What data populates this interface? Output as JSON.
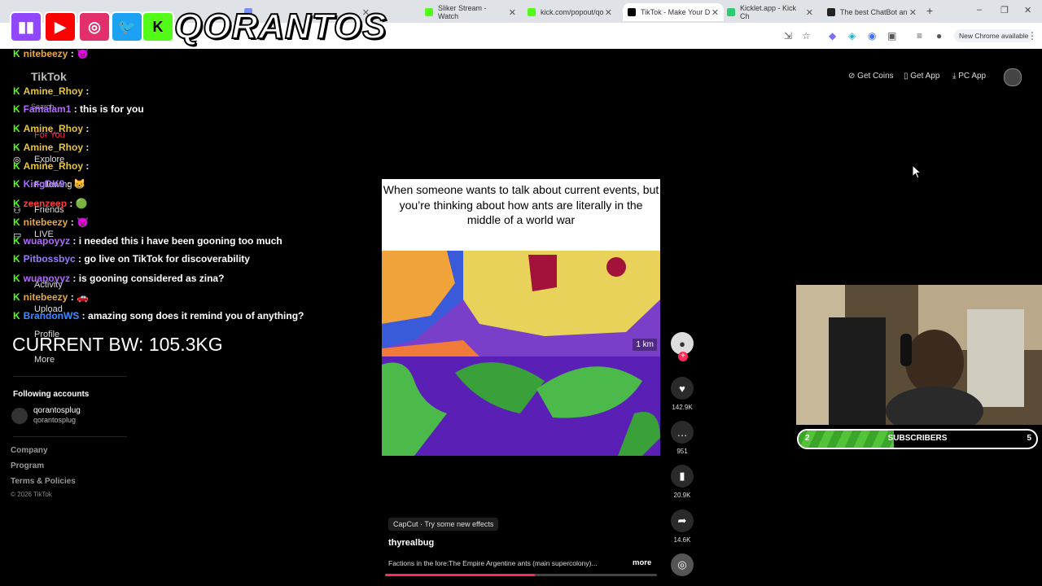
{
  "browser": {
    "tabs": [
      {
        "label": "",
        "fav": "#7b8cff"
      },
      {
        "label": "Sliker Stream - Watch",
        "fav": "#53fc18"
      },
      {
        "label": "kick.com/popout/qo",
        "fav": "#53fc18"
      },
      {
        "label": "TikTok - Make Your D",
        "fav": "#000000"
      },
      {
        "label": "Kicklet.app - Kick Ch",
        "fav": "#2ecc71"
      },
      {
        "label": "The best ChatBot an",
        "fav": "#222222"
      }
    ],
    "new_tab": "+",
    "window_controls": [
      "–",
      "❐",
      "✕"
    ],
    "chrome_button": "New Chrome available"
  },
  "overlay": {
    "socials": [
      {
        "name": "twitch-icon",
        "glyph": "▮▮",
        "color": "#9146ff"
      },
      {
        "name": "youtube-icon",
        "glyph": "▶",
        "color": "#ff0000"
      },
      {
        "name": "instagram-icon",
        "glyph": "◎",
        "color": "#e1306c"
      },
      {
        "name": "twitter-icon",
        "glyph": "🐦",
        "color": "#1da1f2"
      },
      {
        "name": "kick-icon",
        "glyph": "K",
        "color": "#53fc18"
      }
    ],
    "brand": "QORANTOS",
    "bodyweight": "CURRENT BW: 105.3KG"
  },
  "sidebar": {
    "logo": "TikTok",
    "items": [
      "Search",
      "For You",
      "Explore",
      "Following",
      "Friends",
      "LIVE",
      "Activity",
      "Upload",
      "Profile",
      "More"
    ],
    "following_header": "Following accounts",
    "following_user": "qorantosplug",
    "following_handle": "qorantosplug",
    "footer": [
      "Company",
      "Program",
      "Terms & Policies"
    ],
    "copyright": "© 2026 TikTok"
  },
  "chat": [
    {
      "user": "nitebeezy",
      "color": "#e8a93a",
      "msg": "😈"
    },
    {
      "user": "Amine_Rhoy",
      "color": "#e8c63a",
      "msg": ""
    },
    {
      "user": "Famalam1",
      "color": "#b06cff",
      "msg": "this is for you"
    },
    {
      "user": "Amine_Rhoy",
      "color": "#e8c63a",
      "msg": ""
    },
    {
      "user": "Amine_Rhoy",
      "color": "#e8c63a",
      "msg": ""
    },
    {
      "user": "Amine_Rhoy",
      "color": "#e8c63a",
      "msg": ""
    },
    {
      "user": "KingDK9",
      "color": "#a66cff",
      "msg": "😸"
    },
    {
      "user": "zeenzeep",
      "color": "#ff3b3b",
      "msg": "🟢"
    },
    {
      "user": "nitebeezy",
      "color": "#e8a93a",
      "msg": "😈"
    },
    {
      "user": "wuapoyyz",
      "color": "#b06cff",
      "msg": "i needed this i have been gooning too much"
    },
    {
      "user": "Pitbossbyc",
      "color": "#9a7cff",
      "msg": "go live on TikTok for discoverability"
    },
    {
      "user": "wuapoyyz",
      "color": "#b06cff",
      "msg": "is gooning considered as zina?"
    },
    {
      "user": "nitebeezy",
      "color": "#e8a93a",
      "msg": "🚗"
    },
    {
      "user": "BrandonWS",
      "color": "#3a8bff",
      "msg": "amazing song does it remind you of anything?"
    }
  ],
  "topright": {
    "coins": "Get Coins",
    "app": "Get App",
    "pc": "PC App"
  },
  "video": {
    "caption": "When someone wants to talk about current events, but you’re thinking about how ants are literally in the middle of a world war",
    "scale": "1 km"
  },
  "actions": {
    "likes": "142.9K",
    "comments": "951",
    "saves": "20.9K",
    "shares": "14.6K"
  },
  "post": {
    "effect": "CapCut · Try some new effects",
    "author": "thyrealbug",
    "description": "Factions in the lore:The Empire Argentine ants (main supercolony)...",
    "more": "more",
    "progress": 0.55
  },
  "subs": {
    "current": "2",
    "label": "SUBSCRIBERS",
    "goal": "5",
    "fraction": 0.4
  }
}
